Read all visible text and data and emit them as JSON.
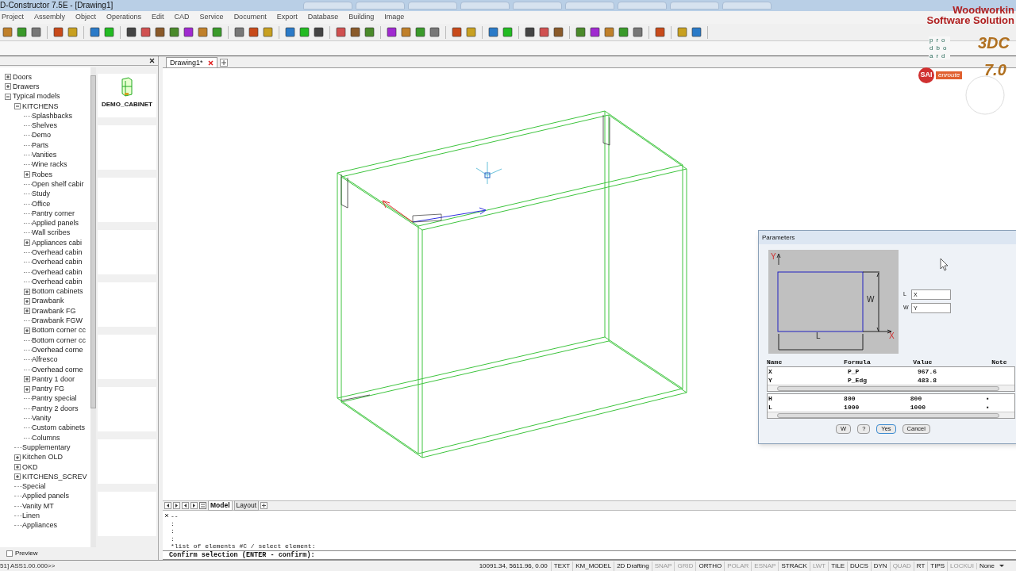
{
  "window": {
    "title": "D-Constructor 7.5E - [Drawing1]"
  },
  "menu": [
    "Project",
    "Assembly",
    "Object",
    "Operations",
    "Edit",
    "CAD",
    "Service",
    "Document",
    "Export",
    "Database",
    "Building",
    "Image"
  ],
  "logos": {
    "line_1": "Woodworkin",
    "line_2": "Software Solution",
    "proboard": [
      "pro",
      "dbo",
      "ard"
    ],
    "sai": "SAI",
    "enroute": "enroute",
    "badge_3d": "3DC",
    "badge_version": "7.0"
  },
  "library": {
    "tree": [
      {
        "label": "Doors",
        "expanded": false
      },
      {
        "label": "Drawers",
        "expanded": false
      },
      {
        "label": "Typical models",
        "expanded": true,
        "children": [
          {
            "label": "KITCHENS",
            "expanded": true,
            "children": [
              {
                "label": "Splashbacks"
              },
              {
                "label": "Shelves"
              },
              {
                "label": "Demo"
              },
              {
                "label": "Parts"
              },
              {
                "label": "Vanities"
              },
              {
                "label": "Wine racks"
              },
              {
                "label": "Robes",
                "expanded": false
              },
              {
                "label": "Open shelf cabir"
              },
              {
                "label": "Study"
              },
              {
                "label": "Office"
              },
              {
                "label": "Pantry corner"
              },
              {
                "label": "Applied panels"
              },
              {
                "label": "Wall scribes"
              },
              {
                "label": "Appliances cabi",
                "expanded": false
              },
              {
                "label": "Overhead cabin"
              },
              {
                "label": "Overhead cabin"
              },
              {
                "label": "Overhead cabin"
              },
              {
                "label": "Overhead cabin"
              },
              {
                "label": "Bottom cabinets",
                "expanded": false
              },
              {
                "label": "Drawbank",
                "expanded": false
              },
              {
                "label": "Drawbank FG",
                "expanded": false
              },
              {
                "label": "Drawbank FGW"
              },
              {
                "label": "Bottom corner cc",
                "expanded": false
              },
              {
                "label": "Bottom corner cc"
              },
              {
                "label": "Overhead corne"
              },
              {
                "label": "Alfresco"
              },
              {
                "label": "Overhead corne"
              },
              {
                "label": "Pantry 1 door",
                "expanded": false
              },
              {
                "label": "Pantry FG",
                "expanded": false
              },
              {
                "label": "Pantry special"
              },
              {
                "label": "Pantry 2 doors"
              },
              {
                "label": "Vanity"
              },
              {
                "label": "Custom cabinets"
              },
              {
                "label": "Columns"
              }
            ]
          },
          {
            "label": "Supplementary"
          },
          {
            "label": "Kitchen OLD",
            "expanded": false
          },
          {
            "label": "OKD",
            "expanded": false
          },
          {
            "label": "KITCHENS_SCREV",
            "expanded": false
          },
          {
            "label": "Special"
          },
          {
            "label": "Applied panels"
          },
          {
            "label": "Vanity MT"
          },
          {
            "label": "Linen"
          },
          {
            "label": "Appliances"
          }
        ]
      }
    ],
    "thumbnail_label": "DEMO_CABINET",
    "preview": {
      "label": "Preview",
      "checked": false
    }
  },
  "document_tabs": [
    {
      "label": "Drawing1*",
      "selected": true
    }
  ],
  "layout_tabs": [
    {
      "label": "Model",
      "selected": true
    },
    {
      "label": "Layout",
      "selected": false
    }
  ],
  "dialog": {
    "title": "Parameters",
    "diagram": {
      "y_axis": "Y",
      "x_axis": "X",
      "width": "W",
      "length": "L"
    },
    "fields": [
      {
        "label": "L",
        "value": "X"
      },
      {
        "label": "W",
        "value": "Y"
      }
    ],
    "columns": [
      "Name",
      "Formula",
      "Value",
      "Note"
    ],
    "table_1": [
      {
        "name": "X",
        "formula": "P_P",
        "value": "967.6"
      },
      {
        "name": "Y",
        "formula": "P_Edg",
        "value": "483.8"
      }
    ],
    "table_2": [
      {
        "name": "H",
        "formula": "800",
        "value": "800",
        "note": "▪"
      },
      {
        "name": "L",
        "formula": "1000",
        "value": "1000",
        "note": "▪"
      }
    ],
    "buttons": [
      {
        "label": "W",
        "default": false
      },
      {
        "label": "?",
        "default": false
      },
      {
        "label": "Yes",
        "default": true
      },
      {
        "label": "Cancel",
        "default": false
      }
    ]
  },
  "command": {
    "history": [
      "--",
      ":",
      ":",
      ":",
      "*list of elements #C / select element:"
    ],
    "prompt": "Confirm selection (ENTER - confirm):"
  },
  "status_bar": {
    "prompt": "51] ASS1.00.000>>",
    "coordinates": "10091.34, 5611.96, 0.00",
    "toggles": [
      {
        "label": "TEXT",
        "on": true
      },
      {
        "label": "KM_MODEL",
        "on": true
      },
      {
        "label": "2D Drafting",
        "on": true
      },
      {
        "label": "SNAP",
        "on": false
      },
      {
        "label": "GRID",
        "on": false
      },
      {
        "label": "ORTHO",
        "on": true
      },
      {
        "label": "POLAR",
        "on": false
      },
      {
        "label": "ESNAP",
        "on": false
      },
      {
        "label": "STRACK",
        "on": true
      },
      {
        "label": "LWT",
        "on": false
      },
      {
        "label": "TILE",
        "on": true
      },
      {
        "label": "DUCS",
        "on": true
      },
      {
        "label": "DYN",
        "on": true
      },
      {
        "label": "QUAD",
        "on": false
      },
      {
        "label": "RT",
        "on": true
      },
      {
        "label": "TIPS",
        "on": true
      },
      {
        "label": "LOCKUI",
        "on": false
      }
    ],
    "dropdown": "None"
  }
}
